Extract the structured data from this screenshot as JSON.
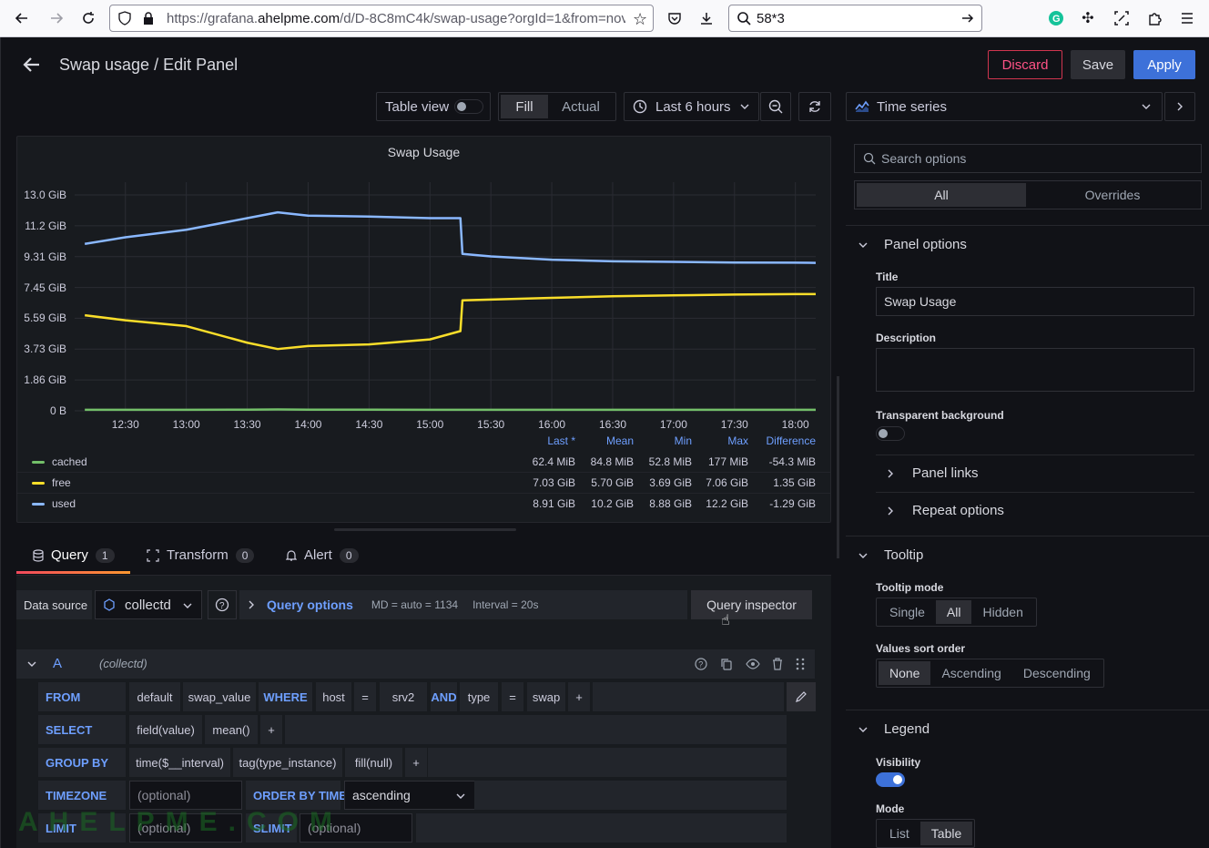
{
  "browser": {
    "url_prefix": "https://grafana.",
    "url_domain": "ahelpme.com",
    "url_suffix": "/d/D-8C8mC4k/swap-usage?orgId=1&from=nov",
    "search": "58*3"
  },
  "header": {
    "title": "Swap usage / Edit Panel",
    "discard": "Discard",
    "save": "Save",
    "apply": "Apply"
  },
  "toolbar": {
    "table_view": "Table view",
    "fill": "Fill",
    "actual": "Actual",
    "time_range": "Last 6 hours",
    "viz": "Time series"
  },
  "panel": {
    "title": "Swap Usage"
  },
  "chart_data": {
    "type": "line",
    "title": "Swap Usage",
    "y_ticks": [
      "13.0 GiB",
      "11.2 GiB",
      "9.31 GiB",
      "7.45 GiB",
      "5.59 GiB",
      "3.73 GiB",
      "1.86 GiB",
      "0 B"
    ],
    "x_ticks": [
      "12:30",
      "13:00",
      "13:30",
      "14:00",
      "14:30",
      "15:00",
      "15:30",
      "16:00",
      "16:30",
      "17:00",
      "17:30",
      "18:00"
    ],
    "ylim": [
      0,
      13.0
    ],
    "x": [
      "12:10",
      "12:30",
      "13:00",
      "13:30",
      "13:45",
      "14:00",
      "14:30",
      "15:00",
      "15:15",
      "15:16",
      "15:30",
      "16:00",
      "16:30",
      "17:00",
      "17:30",
      "18:00",
      "18:10"
    ],
    "series": [
      {
        "name": "cached",
        "color": "#73bf69",
        "values": [
          0.06,
          0.06,
          0.06,
          0.07,
          0.08,
          0.07,
          0.07,
          0.06,
          0.06,
          0.06,
          0.06,
          0.06,
          0.06,
          0.06,
          0.06,
          0.06,
          0.06
        ]
      },
      {
        "name": "free",
        "color": "#fade2a",
        "values": [
          5.75,
          5.45,
          5.1,
          4.1,
          3.72,
          3.9,
          4.0,
          4.3,
          4.8,
          6.65,
          6.7,
          6.8,
          6.9,
          6.95,
          7.0,
          7.03,
          7.03
        ]
      },
      {
        "name": "used",
        "color": "#8ab8ff",
        "values": [
          10.05,
          10.45,
          10.9,
          11.6,
          11.95,
          11.75,
          11.7,
          11.6,
          11.6,
          9.45,
          9.3,
          9.1,
          9.0,
          8.97,
          8.93,
          8.92,
          8.91
        ]
      }
    ],
    "legend": {
      "placement": "bottom",
      "columns": [
        "Last *",
        "Mean",
        "Min",
        "Max",
        "Difference"
      ],
      "rows": [
        {
          "name": "cached",
          "color": "#73bf69",
          "last": "62.4 MiB",
          "mean": "84.8 MiB",
          "min": "52.8 MiB",
          "max": "177 MiB",
          "diff": "-54.3 MiB"
        },
        {
          "name": "free",
          "color": "#fade2a",
          "last": "7.03 GiB",
          "mean": "5.70 GiB",
          "min": "3.69 GiB",
          "max": "7.06 GiB",
          "diff": "1.35 GiB"
        },
        {
          "name": "used",
          "color": "#8ab8ff",
          "last": "8.91 GiB",
          "mean": "10.2 GiB",
          "min": "8.88 GiB",
          "max": "12.2 GiB",
          "diff": "-1.29 GiB"
        }
      ]
    }
  },
  "tabs": {
    "query": "Query",
    "query_count": "1",
    "transform": "Transform",
    "transform_count": "0",
    "alert": "Alert",
    "alert_count": "0"
  },
  "query": {
    "ds_label": "Data source",
    "ds_value": "collectd",
    "options": "Query options",
    "md": "MD = auto = 1134",
    "interval": "Interval = 20s",
    "inspector": "Query inspector",
    "ref": "A",
    "ref_ds": "(collectd)",
    "from": "FROM",
    "from_parts": [
      "default",
      "swap_value",
      "WHERE",
      "host",
      "=",
      "srv2",
      "AND",
      "type",
      "=",
      "swap",
      "+"
    ],
    "select": "SELECT",
    "select_parts": [
      "field(value)",
      "mean()",
      "+"
    ],
    "group": "GROUP BY",
    "group_parts": [
      "time($__interval)",
      "tag(type_instance)",
      "fill(null)",
      "+"
    ],
    "timezone": "TIMEZONE",
    "tz_placeholder": "(optional)",
    "order": "ORDER BY TIME",
    "order_value": "ascending",
    "limit": "LIMIT",
    "limit_placeholder": "(optional)",
    "slimit": "SLIMIT",
    "slimit_placeholder": "(optional)"
  },
  "watermark": "AHELPME.COM",
  "options": {
    "search": "Search options",
    "all": "All",
    "overrides": "Overrides",
    "panel_options": "Panel options",
    "title_label": "Title",
    "title_value": "Swap Usage",
    "desc_label": "Description",
    "transparent": "Transparent background",
    "panel_links": "Panel links",
    "repeat": "Repeat options",
    "tooltip": "Tooltip",
    "tooltip_mode": "Tooltip mode",
    "tt_single": "Single",
    "tt_all": "All",
    "tt_hidden": "Hidden",
    "sort": "Values sort order",
    "sort_none": "None",
    "sort_asc": "Ascending",
    "sort_desc": "Descending",
    "legend": "Legend",
    "visibility": "Visibility",
    "mode": "Mode",
    "mode_list": "List",
    "mode_table": "Table"
  }
}
